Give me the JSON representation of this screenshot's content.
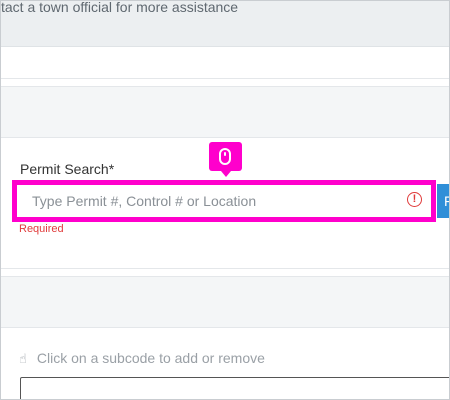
{
  "notice": {
    "text": "tact a town official for more assistance"
  },
  "permit_search": {
    "label": "Permit Search*",
    "placeholder": "Type Permit #, Control # or Location",
    "value": "",
    "validation_message": "Required",
    "error_icon": "exclamation-circle-icon",
    "button_label": "F"
  },
  "pointer_badge": {
    "icon": "mouse-icon"
  },
  "subcodes": {
    "hint_icon": "hand-pointer-icon",
    "hint_text": "Click on a subcode to add or remove"
  },
  "colors": {
    "highlight": "#ff00cc",
    "error": "#e03a3a",
    "button": "#2f8fd8"
  }
}
